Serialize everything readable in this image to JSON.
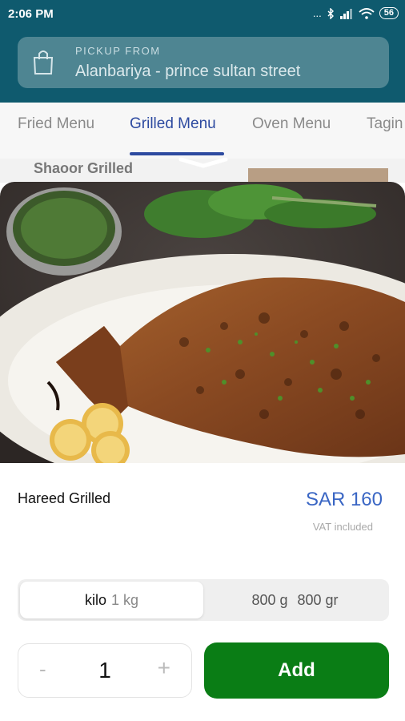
{
  "status": {
    "time": "2:06 PM",
    "dots": "...",
    "battery": "56",
    "icons": [
      "bluetooth-icon",
      "signal-icon",
      "wifi-icon",
      "battery-icon"
    ]
  },
  "pickup": {
    "label": "PICKUP FROM",
    "place": "Alanbariya - prince sultan street",
    "icon": "shopping-bag-icon"
  },
  "tabs": [
    {
      "label": "Fried Menu",
      "active": false
    },
    {
      "label": "Grilled Menu",
      "active": true
    },
    {
      "label": "Oven Menu",
      "active": false
    },
    {
      "label": "Tagin",
      "active": false
    }
  ],
  "behind_item": {
    "name": "Shaoor Grilled"
  },
  "item": {
    "name": "Hareed Grilled",
    "price": "SAR 160",
    "vat": "VAT included"
  },
  "sizes": [
    {
      "name": "kilo",
      "weight": "1 kg",
      "selected": true
    },
    {
      "name": "800 g",
      "weight": "800 gr",
      "selected": false
    }
  ],
  "quantity": {
    "minus": "-",
    "value": "1",
    "plus": "+"
  },
  "add_label": "Add",
  "colors": {
    "header": "#0f5a6e",
    "accent": "#2d4aa0",
    "price": "#3a66c4",
    "add_button": "#0a7d15"
  }
}
